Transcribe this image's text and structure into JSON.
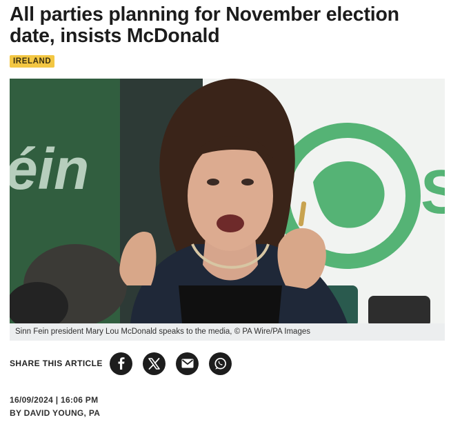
{
  "article": {
    "headline": "All parties planning for November election date, insists McDonald",
    "category": "IRELAND",
    "image_caption": "Sinn Fein president Mary Lou McDonald speaks to the media, © PA Wire/PA Images",
    "share_label": "SHARE THIS ARTICLE",
    "date": "16/09/2024 | 16:06 PM",
    "byline": "BY DAVID YOUNG, PA"
  },
  "photo_backdrop": {
    "left_banner_text": "éin",
    "right_banner_text": "S"
  },
  "share_buttons": [
    {
      "name": "facebook",
      "icon": "facebook-icon"
    },
    {
      "name": "x",
      "icon": "x-icon"
    },
    {
      "name": "email",
      "icon": "email-icon"
    },
    {
      "name": "whatsapp",
      "icon": "whatsapp-icon"
    }
  ],
  "colors": {
    "tag_background": "#f3c743",
    "caption_background": "#eceeef",
    "share_button": "#1d1d1d",
    "banner_green": "#2f5f3a",
    "logo_green": "#35a560"
  }
}
